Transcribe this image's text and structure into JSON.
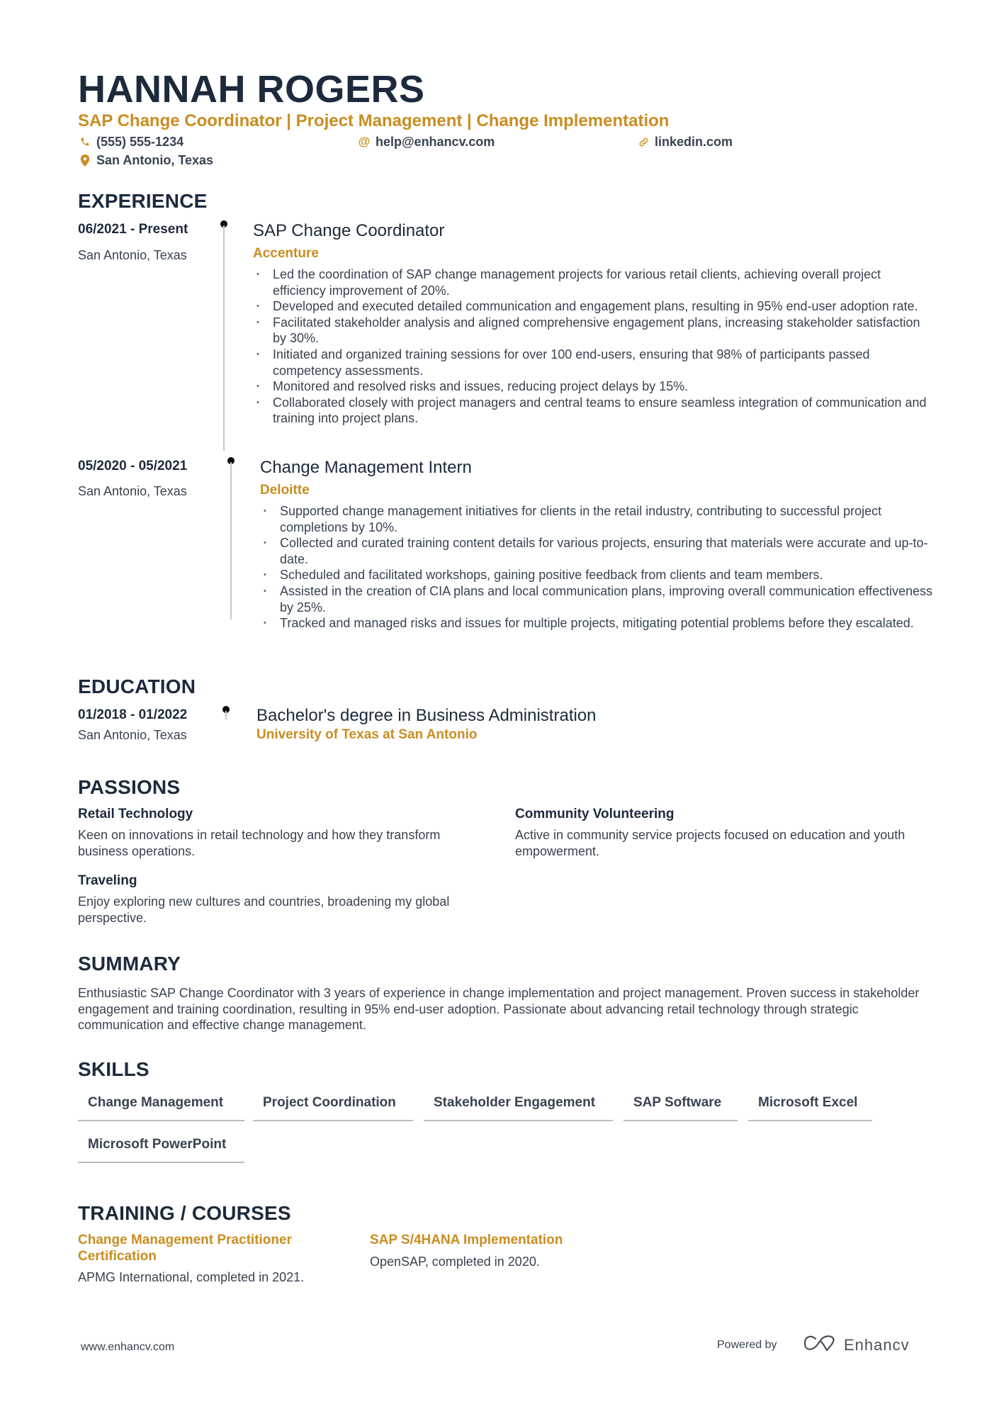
{
  "header": {
    "name": "HANNAH ROGERS",
    "headline": "SAP Change Coordinator | Project Management | Change Implementation",
    "contacts": {
      "phone": "(555) 555-1234",
      "email": "help@enhancv.com",
      "link": "linkedin.com",
      "location": "San Antonio, Texas"
    },
    "icons": {
      "phone": "phone-icon",
      "email": "at-icon",
      "link": "link-icon",
      "location": "map-pin-icon"
    }
  },
  "experience": {
    "title": "EXPERIENCE",
    "items": [
      {
        "dates": "06/2021 - Present",
        "location": "San Antonio, Texas",
        "role": "SAP Change Coordinator",
        "company": "Accenture",
        "bullets": [
          "Led the coordination of SAP change management projects for various retail clients, achieving overall project efficiency improvement of 20%.",
          "Developed and executed detailed communication and engagement plans, resulting in 95% end-user adoption rate.",
          "Facilitated stakeholder analysis and aligned comprehensive engagement plans, increasing stakeholder satisfaction by 30%.",
          "Initiated and organized training sessions for over 100 end-users, ensuring that 98% of participants passed competency assessments.",
          "Monitored and resolved risks and issues, reducing project delays by 15%.",
          "Collaborated closely with project managers and central teams to ensure seamless integration of communication and training into project plans."
        ]
      },
      {
        "dates": "05/2020 - 05/2021",
        "location": "San Antonio, Texas",
        "role": "Change Management Intern",
        "company": "Deloitte",
        "bullets": [
          "Supported change management initiatives for clients in the retail industry, contributing to successful project completions by 10%.",
          "Collected and curated training content details for various projects, ensuring that materials were accurate and up-to-date.",
          "Scheduled and facilitated workshops, gaining positive feedback from clients and team members.",
          "Assisted in the creation of CIA plans and local communication plans, improving overall communication effectiveness by 25%.",
          "Tracked and managed risks and issues for multiple projects, mitigating potential problems before they escalated."
        ]
      }
    ]
  },
  "education": {
    "title": "EDUCATION",
    "items": [
      {
        "dates": "01/2018 - 01/2022",
        "location": "San Antonio, Texas",
        "degree": "Bachelor's degree in Business Administration",
        "school": "University of Texas at San Antonio"
      }
    ]
  },
  "passions": {
    "title": "PASSIONS",
    "items": [
      {
        "title": "Retail Technology",
        "description": "Keen on innovations in retail technology and how they transform business operations."
      },
      {
        "title": "Community Volunteering",
        "description": "Active in community service projects focused on education and youth empowerment."
      },
      {
        "title": "Traveling",
        "description": "Enjoy exploring new cultures and countries, broadening my global perspective."
      }
    ]
  },
  "summary": {
    "title": "SUMMARY",
    "text": "Enthusiastic SAP Change Coordinator with 3 years of experience in change implementation and project management. Proven success in stakeholder engagement and training coordination, resulting in 95% end-user adoption. Passionate about advancing retail technology through strategic communication and effective change management."
  },
  "skills": {
    "title": "SKILLS",
    "items": [
      "Change Management",
      "Project Coordination",
      "Stakeholder Engagement",
      "SAP Software",
      "Microsoft Excel",
      "Microsoft PowerPoint"
    ]
  },
  "training": {
    "title": "TRAINING / COURSES",
    "items": [
      {
        "title": "Change Management Practitioner Certification",
        "description": "APMG International, completed in 2021."
      },
      {
        "title": "SAP S/4HANA Implementation",
        "description": "OpenSAP, completed in 2020."
      }
    ]
  },
  "footer": {
    "website": "www.enhancv.com",
    "powered_by": "Powered by",
    "brand": "Enhancv"
  },
  "colors": {
    "accent": "#c98d21",
    "heading": "#1c2a3c",
    "body": "#384352"
  }
}
